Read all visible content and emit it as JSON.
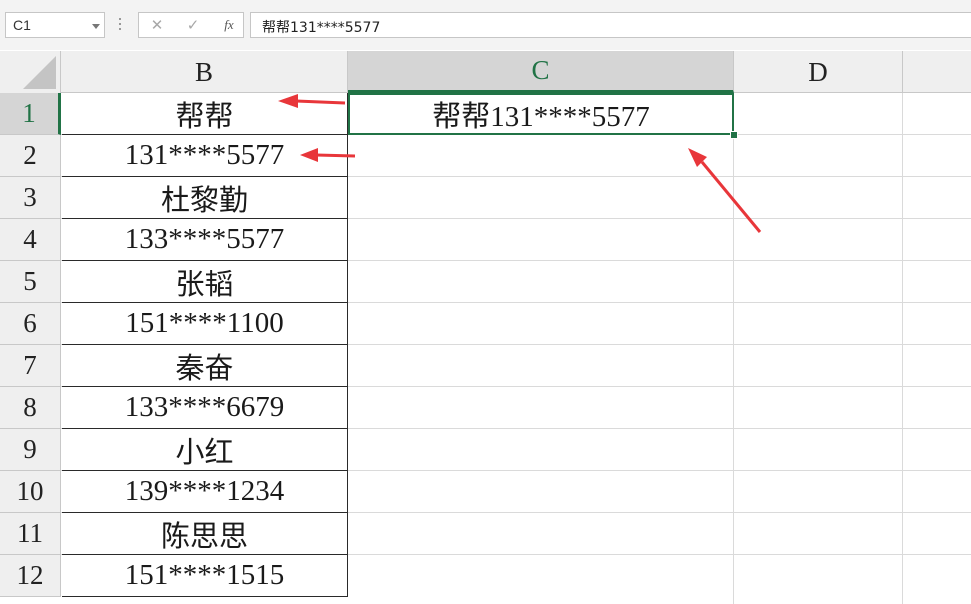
{
  "formula_bar": {
    "name_box": "C1",
    "cancel_symbol": "✕",
    "confirm_symbol": "✓",
    "fx_label": "fx",
    "formula": "帮帮131****5577"
  },
  "columns": [
    "B",
    "C",
    "D"
  ],
  "active_column": "C",
  "rows": [
    "1",
    "2",
    "3",
    "4",
    "5",
    "6",
    "7",
    "8",
    "9",
    "10",
    "11",
    "12"
  ],
  "active_row": "1",
  "cells": {
    "B": [
      "帮帮",
      "131****5577",
      "杜黎勤",
      "133****5577",
      "张韬",
      "151****1100",
      "秦奋",
      "133****6679",
      "小红",
      "139****1234",
      "陈思思",
      "151****1515"
    ],
    "C1": "帮帮131****5577"
  },
  "annotation_color": "#e8363a",
  "accent_color": "#217346"
}
